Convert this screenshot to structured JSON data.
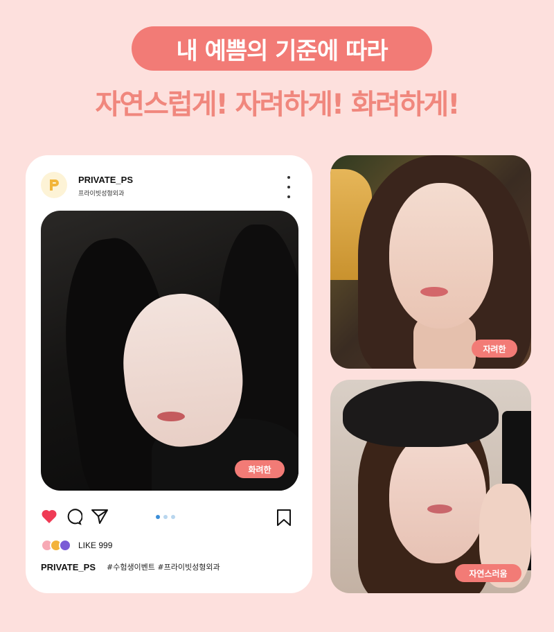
{
  "headline": "내 예쁨의 기준에 따라",
  "subheadline": "자연스럽게! 자려하게! 화려하게!",
  "post": {
    "username": "PRIVATE_PS",
    "subtitle": "프라이빗성형외과",
    "logo_letter": "P",
    "photo_tag": "화려한",
    "likes": "LIKE 999",
    "caption_user": "PRIVATE_PS",
    "caption_tags": "#수험생이벤트 #프라이빗성형외과",
    "icons": [
      "heart-icon",
      "comment-icon",
      "share-icon",
      "bookmark-icon",
      "more-icon"
    ]
  },
  "side_photos": [
    {
      "tag": "자려한"
    },
    {
      "tag": "자연스러움"
    }
  ],
  "colors": {
    "background": "#fde0dd",
    "accent": "#f27b76",
    "subheadline": "#f0877d",
    "heart": "#ef3b55",
    "dot_active": "#3b8ed8"
  }
}
